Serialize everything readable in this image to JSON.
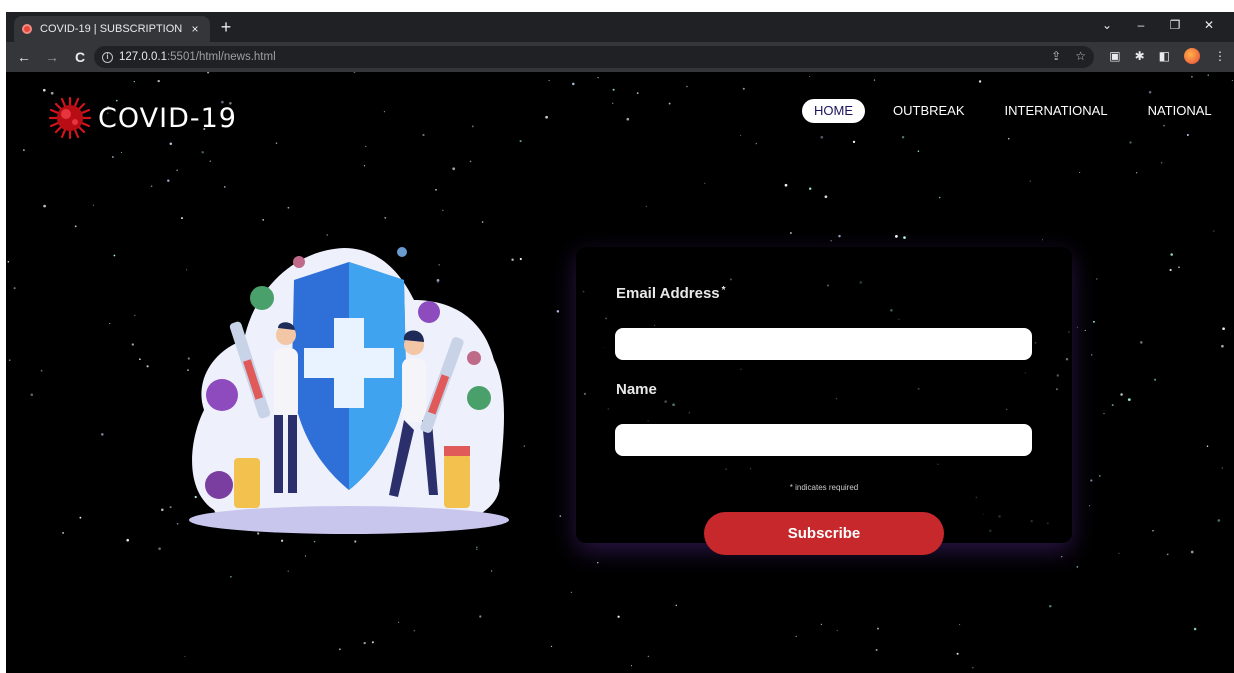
{
  "browser": {
    "tab": {
      "title": "COVID-19 | SUBSCRIPTION",
      "close_glyph": "×"
    },
    "new_tab_glyph": "+",
    "window_controls": {
      "tabs_menu": "⌄",
      "minimize": "–",
      "restore": "❐",
      "close": "✕"
    },
    "nav": {
      "back": "←",
      "forward": "→",
      "reload": "C"
    },
    "url": {
      "host": "127.0.0.1",
      "rest": ":5501/html/news.html"
    },
    "omnibox_icons": {
      "share": "⇪",
      "bookmark": "☆"
    },
    "extension_icons": {
      "ext1": "▣",
      "extensions": "✱",
      "sidepanel": "◧",
      "menu": "⋮"
    }
  },
  "logo": {
    "text": "COVID-19",
    "icon": "virus-icon",
    "icon_color": "#d4141c"
  },
  "navbar": {
    "items": [
      {
        "label": "HOME",
        "active": true
      },
      {
        "label": "OUTBREAK",
        "active": false
      },
      {
        "label": "INTERNATIONAL",
        "active": false
      },
      {
        "label": "NATIONAL",
        "active": false
      }
    ]
  },
  "form": {
    "email_label": "Email Address",
    "required_marker": "*",
    "email_value": "",
    "name_label": "Name",
    "name_value": "",
    "required_note": "* indicates required",
    "submit_label": "Subscribe"
  },
  "colors": {
    "accent": "#c6282b",
    "active_nav_text": "#1d1460",
    "background": "#000000"
  }
}
